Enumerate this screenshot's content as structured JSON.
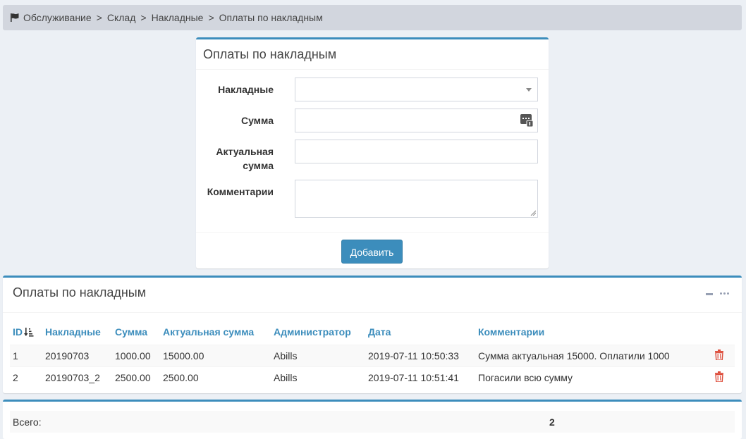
{
  "breadcrumb": {
    "items": [
      "Обслуживание",
      "Склад",
      "Накладные",
      "Оплаты по накладным"
    ],
    "separator": ">"
  },
  "form": {
    "title": "Оплаты по накладным",
    "invoice_label": "Накладные",
    "invoice_value": "",
    "sum_label": "Сумма",
    "sum_value": "",
    "actual_sum_label_line1": "Актуальная",
    "actual_sum_label_line2": "сумма",
    "actual_sum_value": "",
    "comments_label": "Комментарии",
    "comments_value": "",
    "submit_label": "Добавить"
  },
  "list": {
    "title": "Оплаты по накладным",
    "columns": [
      "ID",
      "Накладные",
      "Сумма",
      "Актуальная сумма",
      "Администратор",
      "Дата",
      "Комментарии"
    ],
    "rows": [
      {
        "id": "1",
        "invoice": "20190703",
        "sum": "1000.00",
        "actual_sum": "15000.00",
        "admin": "Abills",
        "date": "2019-07-11 10:50:33",
        "comment": "Сумма актуальная 15000. Оплатили 1000"
      },
      {
        "id": "2",
        "invoice": "20190703_2",
        "sum": "2500.00",
        "actual_sum": "2500.00",
        "admin": "Abills",
        "date": "2019-07-11 10:51:41",
        "comment": "Погасили всю сумму"
      }
    ]
  },
  "total": {
    "label": "Всего:",
    "value": "2"
  },
  "colors": {
    "accent": "#3c8dbc",
    "danger": "#dd4b39",
    "background": "#ecf0f5"
  },
  "icons": {
    "breadcrumb": "flag-icon",
    "sum_field": "calculator-icon",
    "sort": "sort-amount-down-icon",
    "delete": "trash-icon"
  }
}
